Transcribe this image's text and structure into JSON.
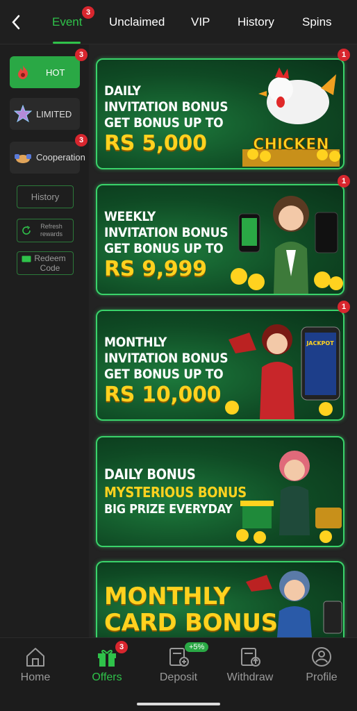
{
  "tabs": [
    {
      "label": "Event",
      "badge": "3",
      "active": true
    },
    {
      "label": "Unclaimed"
    },
    {
      "label": "VIP"
    },
    {
      "label": "History"
    },
    {
      "label": "Spins"
    }
  ],
  "sidebar": {
    "items": [
      {
        "label": "HOT",
        "badge": "3",
        "icon": "flame-icon"
      },
      {
        "label": "LIMITED",
        "icon": "star-icon"
      },
      {
        "label": "Cooperation",
        "badge": "3",
        "icon": "handshake-icon"
      }
    ],
    "history_label": "History",
    "refresh_label": "Refresh rewards",
    "redeem_label": "Redeem Code"
  },
  "banners": [
    {
      "lines": [
        "DAILY",
        "INVITATION BONUS",
        "GET BONUS UP TO"
      ],
      "amount": "RS 5,000",
      "badge": "1",
      "art_text": "CHICKEN ROAD"
    },
    {
      "lines": [
        "WEEKLY",
        "INVITATION BONUS",
        "GET BONUS UP TO"
      ],
      "amount": "RS 9,999",
      "badge": "1"
    },
    {
      "lines": [
        "MONTHLY",
        "INVITATION BONUS",
        "GET BONUS UP TO"
      ],
      "amount": "RS 10,000",
      "badge": "1",
      "art_text": "BIG JACKPOT"
    },
    {
      "lines": [
        "DAILY BONUS",
        "MYSTERIOUS BONUS",
        "BIG PRIZE EVERYDAY"
      ]
    },
    {
      "lines": [
        "MONTHLY",
        "CARD BONUS"
      ]
    }
  ],
  "bottom_nav": [
    {
      "label": "Home",
      "icon": "home-icon"
    },
    {
      "label": "Offers",
      "icon": "gift-icon",
      "badge": "3",
      "active": true
    },
    {
      "label": "Deposit",
      "icon": "deposit-icon",
      "pill": "+5%"
    },
    {
      "label": "Withdraw",
      "icon": "withdraw-icon"
    },
    {
      "label": "Profile",
      "icon": "profile-icon"
    }
  ],
  "colors": {
    "accent": "#2fc24a",
    "badge": "#d8262e",
    "gold": "#ffd21f",
    "banner_border": "#3ad36a"
  }
}
